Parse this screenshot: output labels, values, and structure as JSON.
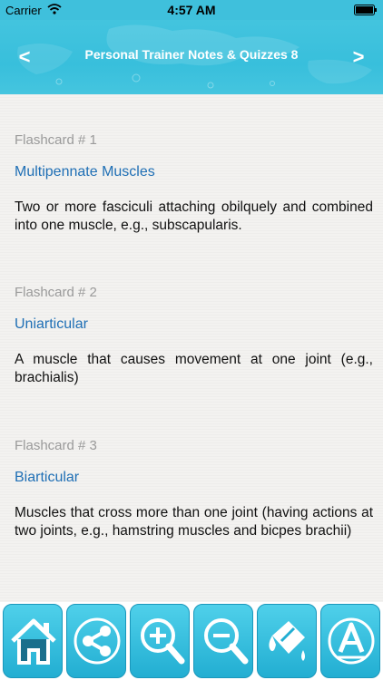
{
  "status_bar": {
    "carrier": "Carrier",
    "time": "4:57 AM"
  },
  "header": {
    "title": "Personal Trainer Notes & Quizzes 8",
    "prev_label": "<",
    "next_label": ">"
  },
  "flashcards": [
    {
      "number": "Flashcard # 1",
      "term": "Multipennate Muscles",
      "definition": "Two or more fasciculi attaching obilquely and combined into one muscle, e.g., subscapularis."
    },
    {
      "number": "Flashcard # 2",
      "term": "Uniarticular",
      "definition": "A muscle that causes movement at one joint (e.g., brachialis)"
    },
    {
      "number": "Flashcard # 3",
      "term": "Biarticular",
      "definition": "Muscles that cross more than one joint (having actions at two joints, e.g., hamstring muscles and bicpes brachii)"
    }
  ],
  "toolbar": {
    "buttons": [
      {
        "icon": "home-icon"
      },
      {
        "icon": "share-icon"
      },
      {
        "icon": "zoom-in-icon"
      },
      {
        "icon": "zoom-out-icon"
      },
      {
        "icon": "paint-bucket-icon"
      },
      {
        "icon": "font-icon"
      }
    ]
  },
  "colors": {
    "accent": "#3fc0dc",
    "term": "#1f6fb5",
    "number": "#9a9a9a"
  }
}
